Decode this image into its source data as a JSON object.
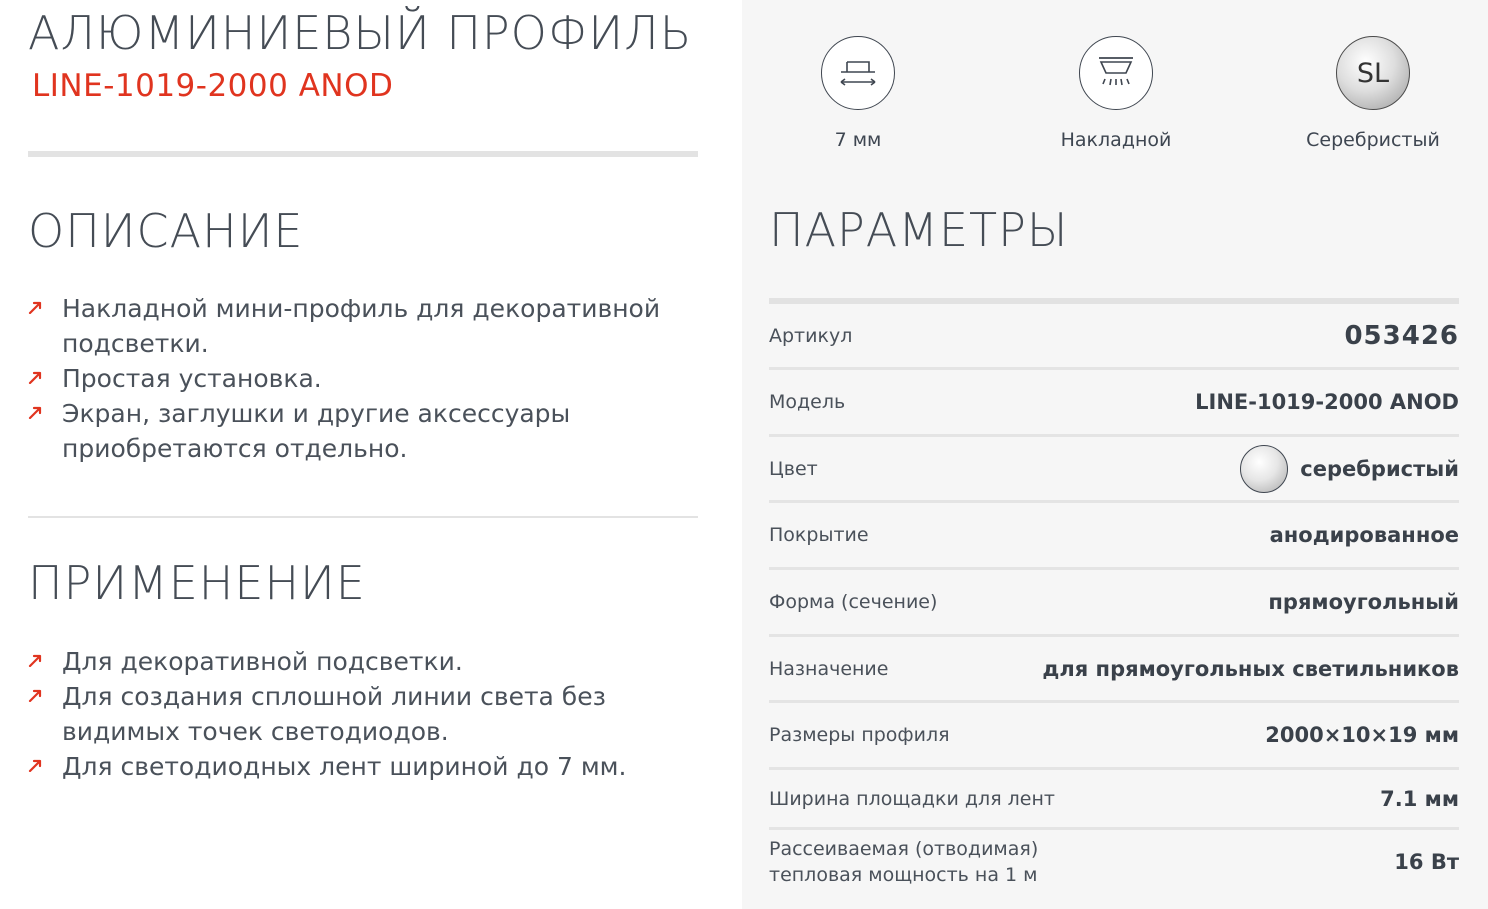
{
  "product": {
    "title": "АЛЮМИНИЕВЫЙ ПРОФИЛЬ",
    "model": "LINE-1019-2000 ANOD"
  },
  "description": {
    "title": "ОПИСАНИЕ",
    "items": [
      "Накладной мини-профиль для декоративной подсветки.",
      "Простая установка.",
      "Экран, заглушки и другие аксессуары приобретаются отдельно."
    ]
  },
  "application": {
    "title": "ПРИМЕНЕНИЕ",
    "items": [
      "Для декоративной подсветки.",
      "Для создания сплошной линии света без видимых точек светодиодов.",
      "Для светодиодных лент шириной до 7 мм."
    ]
  },
  "features": [
    {
      "icon": "strip-width-icon",
      "label": "7 мм"
    },
    {
      "icon": "surface-mount-icon",
      "label": "Накладной"
    },
    {
      "icon": "silver-color-icon",
      "badge": "SL",
      "label": "Серебристый"
    }
  ],
  "params": {
    "title": "ПАРАМЕТРЫ",
    "rows": [
      {
        "label": "Артикул",
        "value": "053426"
      },
      {
        "label": "Модель",
        "value": "LINE-1019-2000 ANOD"
      },
      {
        "label": "Цвет",
        "value": "серебристый"
      },
      {
        "label": "Покрытие",
        "value": "анодированное"
      },
      {
        "label": "Форма (сечение)",
        "value": "прямоугольный"
      },
      {
        "label": "Назначение",
        "value": "для прямоугольных светильников"
      },
      {
        "label": "Размеры профиля",
        "value": "2000×10×19 мм"
      },
      {
        "label": "Ширина площадки для лент",
        "value": "7.1 мм"
      },
      {
        "label_line1": "Рассеиваемая (отводимая)",
        "label_line2": "тепловая мощность на 1 м",
        "value": "16 Вт"
      }
    ]
  },
  "colors": {
    "accent": "#e0341f",
    "text": "#3e4651",
    "panel": "#f6f6f6",
    "divider": "#e3e3e3"
  }
}
